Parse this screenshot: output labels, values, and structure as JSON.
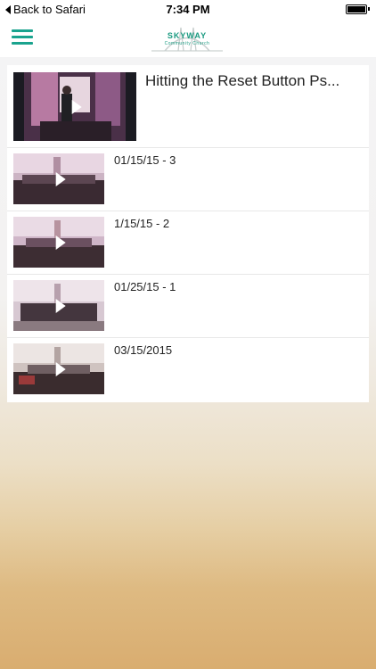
{
  "status_bar": {
    "back_label": "Back to Safari",
    "time": "7:34 PM"
  },
  "header": {
    "logo_name": "SKYWAY",
    "logo_tagline": "Community Church",
    "menu_icon": "hamburger-icon"
  },
  "featured": {
    "title": "Hitting the Reset Button  Ps..."
  },
  "videos": [
    {
      "title": "01/15/15 - 3"
    },
    {
      "title": "1/15/15 - 2"
    },
    {
      "title": "01/25/15 - 1"
    },
    {
      "title": "03/15/2015"
    }
  ],
  "colors": {
    "accent": "#1aa38e"
  }
}
